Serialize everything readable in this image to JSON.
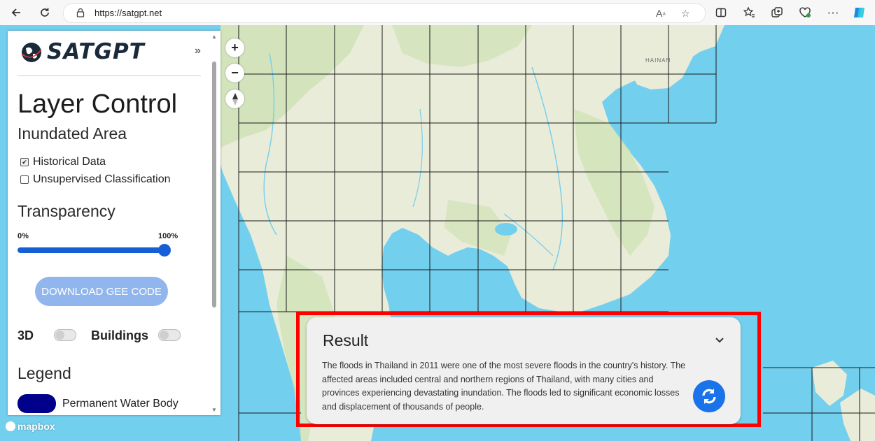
{
  "browser": {
    "url": "https://satgpt.net"
  },
  "map": {
    "place_label": "HAINAN",
    "attribution": "mapbox"
  },
  "sidebar": {
    "logo_text": "SATGPT",
    "collapse_icon": "»",
    "title": "Layer Control",
    "section_inundated": "Inundated Area",
    "checkboxes": [
      {
        "label": "Historical Data",
        "checked": true
      },
      {
        "label": "Unsupervised Classification",
        "checked": false
      }
    ],
    "transparency_title": "Transparency",
    "slider_min_label": "0%",
    "slider_max_label": "100%",
    "slider_value_percent": 100,
    "download_button": "DOWNLOAD GEE CODE",
    "toggle_3d_label": "3D",
    "toggle_buildings_label": "Buildings",
    "legend_title": "Legend",
    "legend_items": [
      {
        "label": "Permanent Water Body",
        "color": "#00008b"
      }
    ]
  },
  "result": {
    "title": "Result",
    "text": "The floods in Thailand in 2011 were one of the most severe floods in the country's history. The affected areas included central and northern regions of Thailand, with many cities and provinces experiencing devastating inundation. The floods led to significant economic losses and displacement of thousands of people."
  },
  "colors": {
    "accent_blue": "#1560d6",
    "highlight_border": "#ff0000",
    "water": "#73cfee",
    "land": "#e9ecd8"
  }
}
